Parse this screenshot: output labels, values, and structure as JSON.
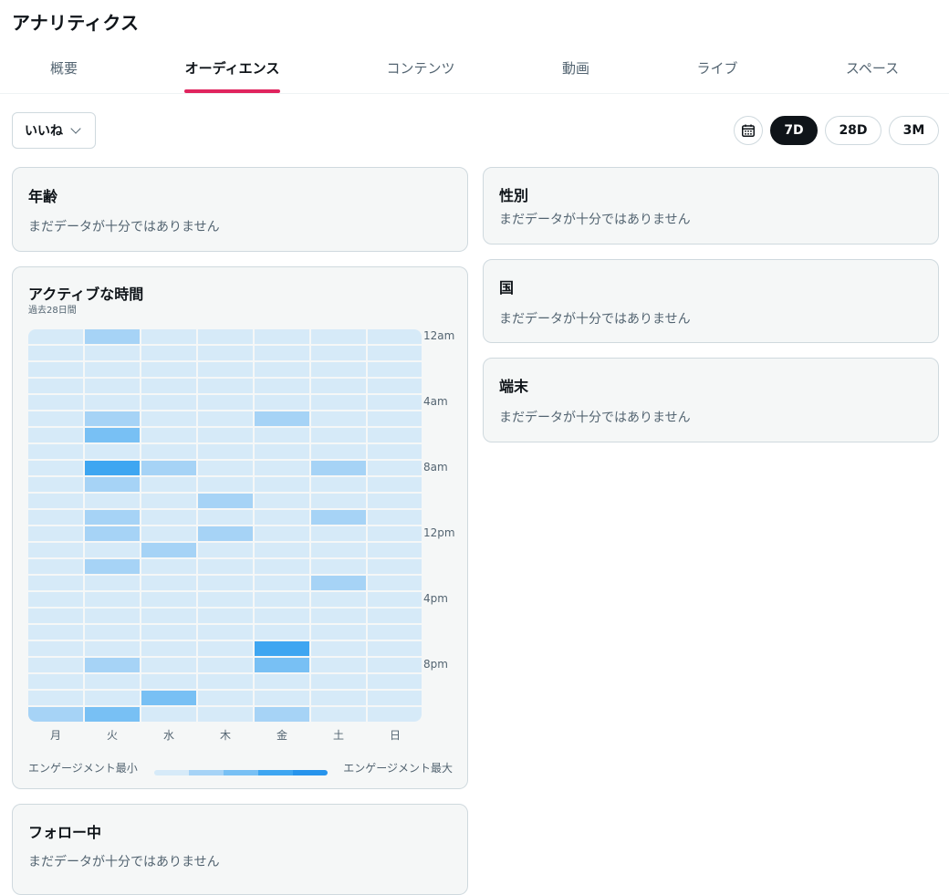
{
  "page": {
    "title": "アナリティクス"
  },
  "tabs": [
    {
      "label": "概要"
    },
    {
      "label": "オーディエンス"
    },
    {
      "label": "コンテンツ"
    },
    {
      "label": "動画"
    },
    {
      "label": "ライブ"
    },
    {
      "label": "スペース"
    }
  ],
  "active_tab": 1,
  "filters": {
    "metric": "いいね",
    "calendar_icon": "calendar-icon",
    "ranges": [
      "7D",
      "28D",
      "3M"
    ],
    "active_range": "7D"
  },
  "no_data_text": "まだデータが十分ではありません",
  "cards": {
    "age": {
      "title": "年齢",
      "message": "まだデータが十分ではありません"
    },
    "gender": {
      "title": "性別",
      "message": "まだデータが十分ではありません"
    },
    "country": {
      "title": "国",
      "message": "まだデータが十分ではありません"
    },
    "device": {
      "title": "端末",
      "message": "まだデータが十分ではありません"
    },
    "following": {
      "title": "フォロー中",
      "message": "まだデータが十分ではありません"
    }
  },
  "colors": {
    "accent": "#e0245e",
    "level0": "#d6eaf8",
    "level1": "#a6d3f6",
    "level2": "#78c0f4",
    "level3": "#3ea6f1",
    "level4": "#2794ec"
  },
  "active_hours": {
    "title": "アクティブな時間",
    "subtitle": "過去28日間",
    "legend_min": "エンゲージメント最小",
    "legend_max": "エンゲージメント最大",
    "days": [
      "月",
      "火",
      "水",
      "木",
      "金",
      "土",
      "日"
    ],
    "hour_labels": [
      "12am",
      "4am",
      "8am",
      "12pm",
      "4pm",
      "8pm"
    ]
  },
  "chart_data": {
    "type": "heatmap",
    "title": "アクティブな時間",
    "subtitle": "過去28日間",
    "x": [
      "月",
      "火",
      "水",
      "木",
      "金",
      "土",
      "日"
    ],
    "y_tick_labels": [
      "12am",
      "4am",
      "8am",
      "12pm",
      "4pm",
      "8pm"
    ],
    "rows": 24,
    "value_range": [
      0,
      4
    ],
    "values": [
      [
        0,
        1,
        0,
        0,
        0,
        0,
        0
      ],
      [
        0,
        0,
        0,
        0,
        0,
        0,
        0
      ],
      [
        0,
        0,
        0,
        0,
        0,
        0,
        0
      ],
      [
        0,
        0,
        0,
        0,
        0,
        0,
        0
      ],
      [
        0,
        0,
        0,
        0,
        0,
        0,
        0
      ],
      [
        0,
        1,
        0,
        0,
        1,
        0,
        0
      ],
      [
        0,
        2,
        0,
        0,
        0,
        0,
        0
      ],
      [
        0,
        0,
        0,
        0,
        0,
        0,
        0
      ],
      [
        0,
        3,
        1,
        0,
        0,
        1,
        0
      ],
      [
        0,
        1,
        0,
        0,
        0,
        0,
        0
      ],
      [
        0,
        0,
        0,
        1,
        0,
        0,
        0
      ],
      [
        0,
        1,
        0,
        0,
        0,
        1,
        0
      ],
      [
        0,
        1,
        0,
        1,
        0,
        0,
        0
      ],
      [
        0,
        0,
        1,
        0,
        0,
        0,
        0
      ],
      [
        0,
        1,
        0,
        0,
        0,
        0,
        0
      ],
      [
        0,
        0,
        0,
        0,
        0,
        1,
        0
      ],
      [
        0,
        0,
        0,
        0,
        0,
        0,
        0
      ],
      [
        0,
        0,
        0,
        0,
        0,
        0,
        0
      ],
      [
        0,
        0,
        0,
        0,
        0,
        0,
        0
      ],
      [
        0,
        0,
        0,
        0,
        3,
        0,
        0
      ],
      [
        0,
        1,
        0,
        0,
        2,
        0,
        0
      ],
      [
        0,
        0,
        0,
        0,
        0,
        0,
        0
      ],
      [
        0,
        0,
        2,
        0,
        0,
        0,
        0
      ],
      [
        1,
        2,
        0,
        0,
        1,
        0,
        0
      ]
    ],
    "legend": [
      "エンゲージメント最小",
      "エンゲージメント最大"
    ]
  }
}
